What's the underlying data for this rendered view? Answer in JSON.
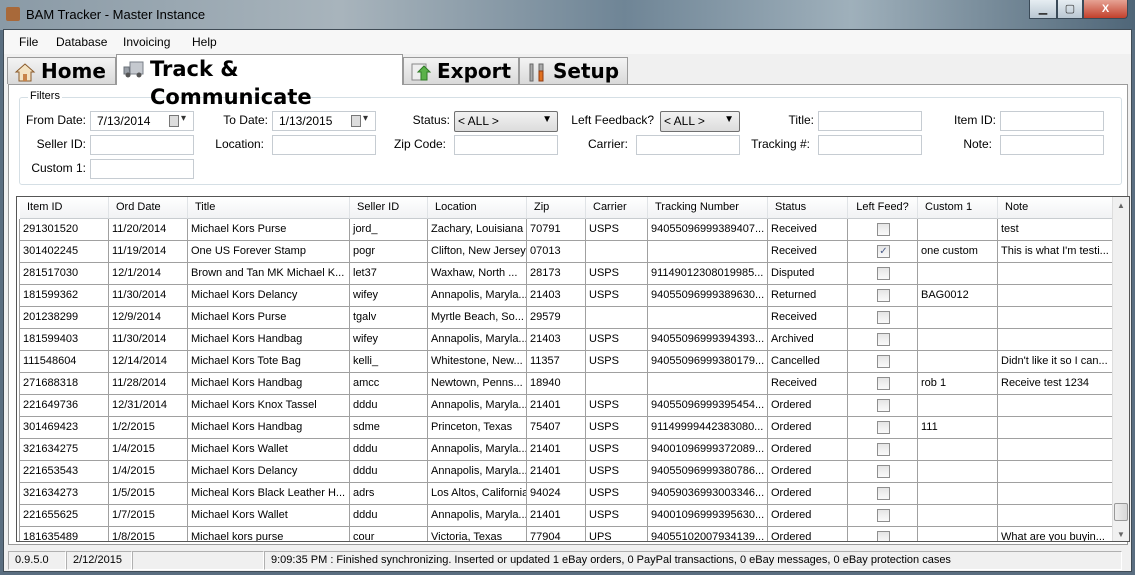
{
  "window": {
    "title": "BAM Tracker - Master Instance",
    "minimize": "▁",
    "maximize": "▢",
    "close": "X"
  },
  "menu": [
    "File",
    "Database",
    "Invoicing",
    "Help"
  ],
  "tabs": [
    {
      "label": "Home",
      "icon": "house-icon"
    },
    {
      "label": "Track & Communicate",
      "icon": "truck-icon",
      "active": true
    },
    {
      "label": "Export",
      "icon": "export-icon"
    },
    {
      "label": "Setup",
      "icon": "tools-icon"
    }
  ],
  "filters": {
    "legend": "Filters",
    "from_date": {
      "label": "From Date:",
      "value": "7/13/2014"
    },
    "to_date": {
      "label": "To Date:",
      "value": "1/13/2015"
    },
    "status": {
      "label": "Status:",
      "value": "< ALL >"
    },
    "left_feedback": {
      "label": "Left Feedback?",
      "value": "< ALL >"
    },
    "title": {
      "label": "Title:",
      "value": ""
    },
    "item_id": {
      "label": "Item ID:",
      "value": ""
    },
    "seller_id": {
      "label": "Seller ID:",
      "value": ""
    },
    "location": {
      "label": "Location:",
      "value": ""
    },
    "zip_code": {
      "label": "Zip Code:",
      "value": ""
    },
    "carrier": {
      "label": "Carrier:",
      "value": ""
    },
    "tracking": {
      "label": "Tracking #:",
      "value": ""
    },
    "note": {
      "label": "Note:",
      "value": ""
    },
    "custom1": {
      "label": "Custom 1:",
      "value": ""
    }
  },
  "grid": {
    "columns": [
      "Item ID",
      "Ord Date",
      "Title",
      "Seller ID",
      "Location",
      "Zip",
      "Carrier",
      "Tracking Number",
      "Status",
      "Left Feed?",
      "Custom 1",
      "Note"
    ],
    "rows": [
      [
        "291301520",
        "11/20/2014",
        "Michael Kors Purse",
        "jord_",
        "Zachary, Louisiana",
        "70791",
        "USPS",
        "94055096999389407...",
        "Received",
        false,
        "",
        "test"
      ],
      [
        "301402245",
        "11/19/2014",
        "One US Forever Stamp",
        "pogr",
        "Clifton, New Jersey",
        "07013",
        "",
        "",
        "Received",
        true,
        "one custom",
        "This is what I'm testi..."
      ],
      [
        "281517030",
        "12/1/2014",
        "Brown and Tan MK Michael K...",
        "let37",
        "Waxhaw, North ...",
        "28173",
        "USPS",
        "91149012308019985...",
        "Disputed",
        false,
        "",
        ""
      ],
      [
        "181599362",
        "11/30/2014",
        "Michael Kors Delancy",
        "wifey",
        "Annapolis, Maryla...",
        "21403",
        "USPS",
        "94055096999389630...",
        "Returned",
        false,
        "BAG0012",
        ""
      ],
      [
        "201238299",
        "12/9/2014",
        "Michael Kors Purse",
        "tgalv",
        "Myrtle Beach, So...",
        "29579",
        "",
        "",
        "Received",
        false,
        "",
        ""
      ],
      [
        "181599403",
        "11/30/2014",
        "Michael Kors Handbag",
        "wifey",
        "Annapolis, Maryla...",
        "21403",
        "USPS",
        "94055096999394393...",
        "Archived",
        false,
        "",
        ""
      ],
      [
        "111548604",
        "12/14/2014",
        "Michael Kors Tote Bag",
        "kelli_",
        "Whitestone, New...",
        "11357",
        "USPS",
        "94055096999380179...",
        "Cancelled",
        false,
        "",
        "Didn't like it so I can..."
      ],
      [
        "271688318",
        "11/28/2014",
        "Michael Kors Handbag",
        "amcc",
        "Newtown, Penns...",
        "18940",
        "",
        "",
        "Received",
        false,
        "rob 1",
        "Receive test 1234"
      ],
      [
        "221649736",
        "12/31/2014",
        "Michael Kors Knox Tassel",
        "dddu",
        "Annapolis, Maryla...",
        "21401",
        "USPS",
        "94055096999395454...",
        "Ordered",
        false,
        "",
        ""
      ],
      [
        "301469423",
        "1/2/2015",
        "Michael Kors Handbag",
        "sdme",
        "Princeton, Texas",
        "75407",
        "USPS",
        "91149999442383080...",
        "Ordered",
        false,
        "111",
        ""
      ],
      [
        "321634275",
        "1/4/2015",
        "Michael Kors Wallet",
        "dddu",
        "Annapolis, Maryla...",
        "21401",
        "USPS",
        "94001096999372089...",
        "Ordered",
        false,
        "",
        ""
      ],
      [
        "221653543",
        "1/4/2015",
        "Michael Kors Delancy",
        "dddu",
        "Annapolis, Maryla...",
        "21401",
        "USPS",
        "94055096999380786...",
        "Ordered",
        false,
        "",
        ""
      ],
      [
        "321634273",
        "1/5/2015",
        "Micheal Kors Black Leather H...",
        "adrs",
        "Los Altos, California",
        "94024",
        "USPS",
        "94059036993003346...",
        "Ordered",
        false,
        "",
        ""
      ],
      [
        "221655625",
        "1/7/2015",
        "Michael Kors Wallet",
        "dddu",
        "Annapolis, Maryla...",
        "21401",
        "USPS",
        "94001096999395630...",
        "Ordered",
        false,
        "",
        ""
      ],
      [
        "181635489",
        "1/8/2015",
        "Michael kors purse",
        "cour",
        "Victoria, Texas",
        "77904",
        "UPS",
        "94055102007934139...",
        "Ordered",
        false,
        "",
        "What are you buyin..."
      ]
    ]
  },
  "statusbar": {
    "version": "0.9.5.0",
    "date": "2/12/2015",
    "blank": "",
    "message": "9:09:35 PM : Finished synchronizing. Inserted or updated 1 eBay orders, 0 PayPal transactions, 0 eBay messages, 0 eBay protection cases"
  }
}
